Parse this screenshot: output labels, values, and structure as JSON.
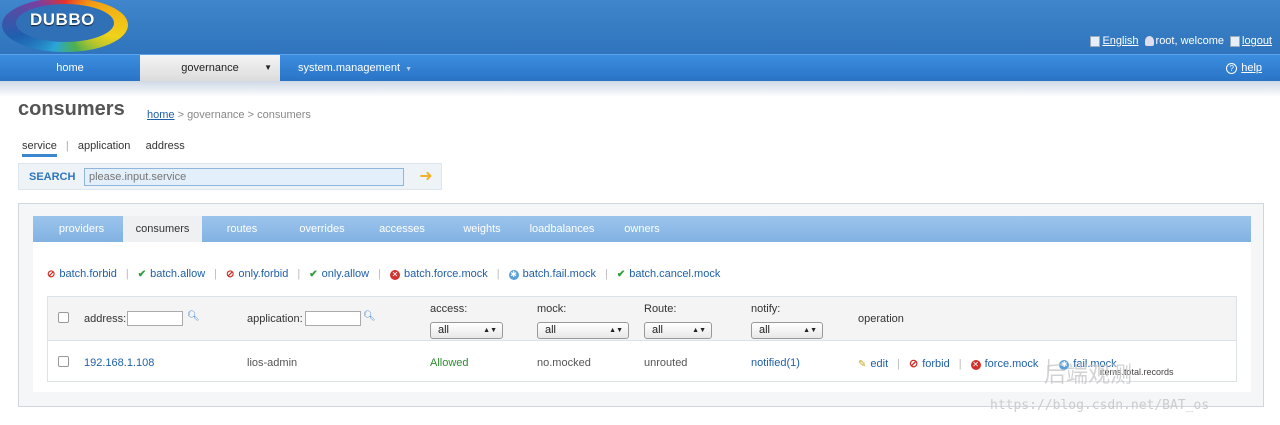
{
  "app": {
    "logo_text": "DUBBO"
  },
  "topbar": {
    "language": "English",
    "welcome": "root, welcome",
    "logout": "logout"
  },
  "nav": {
    "home": "home",
    "governance": "governance",
    "system_management": "system.management",
    "help": "help"
  },
  "page": {
    "title": "consumers",
    "breadcrumb": {
      "home": "home",
      "rest": " > governance > consumers"
    }
  },
  "search": {
    "tabs": [
      "service",
      "application",
      "address"
    ],
    "label": "SEARCH",
    "placeholder": "please.input.service"
  },
  "tabs": [
    "providers",
    "consumers",
    "routes",
    "overrides",
    "accesses",
    "weights",
    "loadbalances",
    "owners"
  ],
  "active_tab": "consumers",
  "actions": [
    {
      "label": "batch.forbid",
      "icon": "forbid-icon"
    },
    {
      "label": "batch.allow",
      "icon": "check-icon"
    },
    {
      "label": "only.forbid",
      "icon": "forbid-icon"
    },
    {
      "label": "only.allow",
      "icon": "check-icon"
    },
    {
      "label": "batch.force.mock",
      "icon": "force-mock-icon"
    },
    {
      "label": "batch.fail.mock",
      "icon": "fail-mock-icon"
    },
    {
      "label": "batch.cancel.mock",
      "icon": "check-icon"
    }
  ],
  "table": {
    "headers": {
      "address": "address:",
      "application": "application:",
      "access": "access:",
      "mock": "mock:",
      "route": "Route:",
      "notify": "notify:",
      "operation": "operation"
    },
    "filters": {
      "access": "all",
      "mock": "all",
      "route": "all",
      "notify": "all"
    },
    "rows": [
      {
        "address": "192.168.1.108",
        "application": "lios-admin",
        "access": "Allowed",
        "mock": "no.mocked",
        "route": "unrouted",
        "notify": "notified(1)",
        "ops": [
          "edit",
          "forbid",
          "force.mock",
          "fail.mock"
        ]
      }
    ]
  },
  "footer_note": "items.total.records",
  "watermark": "后端观测",
  "source_mark": "https://blog.csdn.net/BAT_os",
  "colors": {
    "header_blue": "#2f74bc",
    "link_blue": "#1f5fa8",
    "allowed_green": "#2f8a2f",
    "forbid_red": "#d0312d"
  }
}
